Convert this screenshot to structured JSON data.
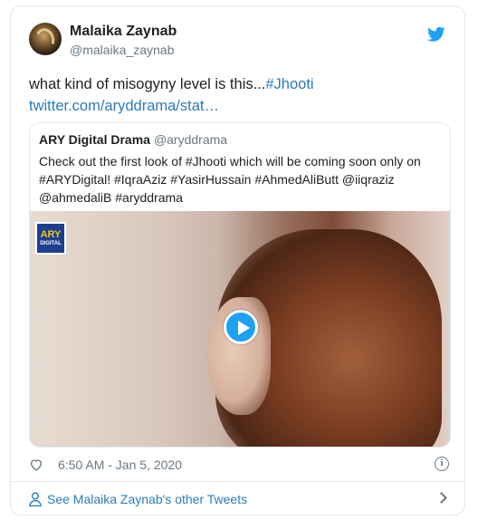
{
  "author": {
    "name": "Malaika Zaynab",
    "handle": "@malaika_zaynab",
    "avatar_icon": "avatar-image"
  },
  "tweet": {
    "text_prefix": "what kind of misogyny level is this...",
    "hashtag": "#Jhooti",
    "link": "twitter.com/aryddrama/stat…"
  },
  "quoted": {
    "name": "ARY Digital Drama",
    "handle": "@aryddrama",
    "text": "Check out the first look of #Jhooti which will be coming soon only on #ARYDigital! #IqraAziz #YasirHussain #AhmedAliButt @iiqraziz @ahmedaliB #aryddrama",
    "logo_top": "ARY",
    "logo_bottom": "DIGITAL"
  },
  "meta": {
    "timestamp": "6:50 AM - Jan 5, 2020",
    "info_glyph": "i"
  },
  "footer": {
    "see_more": "See Malaika Zaynab's other Tweets"
  },
  "colors": {
    "accent": "#1da1f2",
    "link": "#2b7bb9",
    "muted": "#697882",
    "border": "#e1e8ed"
  }
}
